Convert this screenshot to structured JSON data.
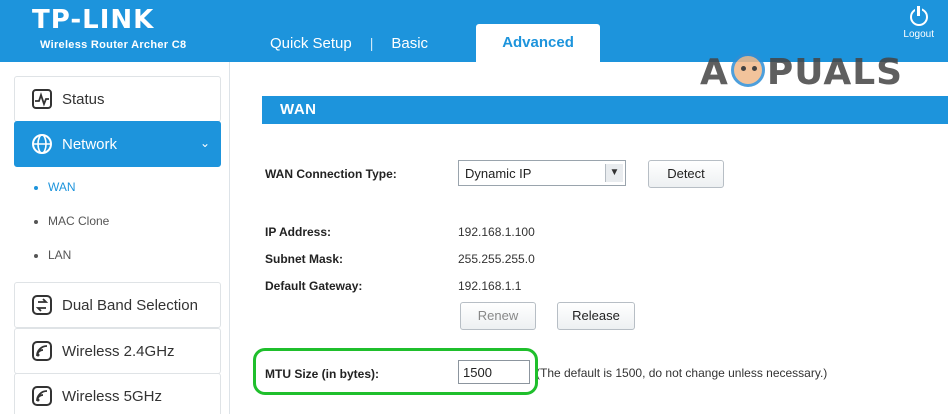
{
  "header": {
    "brand_name": "TP-LINK",
    "brand_model": "Wireless Router Archer C8",
    "tabs": [
      {
        "label": "Quick Setup"
      },
      {
        "label": "Basic"
      },
      {
        "label": "Advanced",
        "active": true
      }
    ],
    "logout_label": "Logout",
    "logout_icon": "power-icon"
  },
  "watermark": {
    "left": "A",
    "right": "PUALS"
  },
  "sidebar": {
    "items": [
      {
        "label": "Status",
        "icon": "status-icon"
      },
      {
        "label": "Network",
        "icon": "globe-icon",
        "active": true
      },
      {
        "label": "Dual Band Selection",
        "icon": "dual-band-icon"
      },
      {
        "label": "Wireless 2.4GHz",
        "icon": "wireless-icon"
      },
      {
        "label": "Wireless 5GHz",
        "icon": "wireless-icon"
      }
    ],
    "sub_items": [
      {
        "label": "WAN",
        "current": true
      },
      {
        "label": "MAC Clone"
      },
      {
        "label": "LAN"
      }
    ]
  },
  "main": {
    "section_title": "WAN",
    "connection_type_label": "WAN Connection Type:",
    "connection_type_value": "Dynamic IP",
    "detect_label": "Detect",
    "ip_label": "IP Address:",
    "ip_value": "192.168.1.100",
    "subnet_label": "Subnet Mask:",
    "subnet_value": "255.255.255.0",
    "gateway_label": "Default Gateway:",
    "gateway_value": "192.168.1.1",
    "renew_label": "Renew",
    "release_label": "Release",
    "mtu_label": "MTU Size (in bytes):",
    "mtu_value": "1500",
    "mtu_note": "(The default is 1500, do not change unless necessary.)"
  },
  "colors": {
    "accent": "#1d94dc",
    "highlight": "#1fbf2c"
  }
}
